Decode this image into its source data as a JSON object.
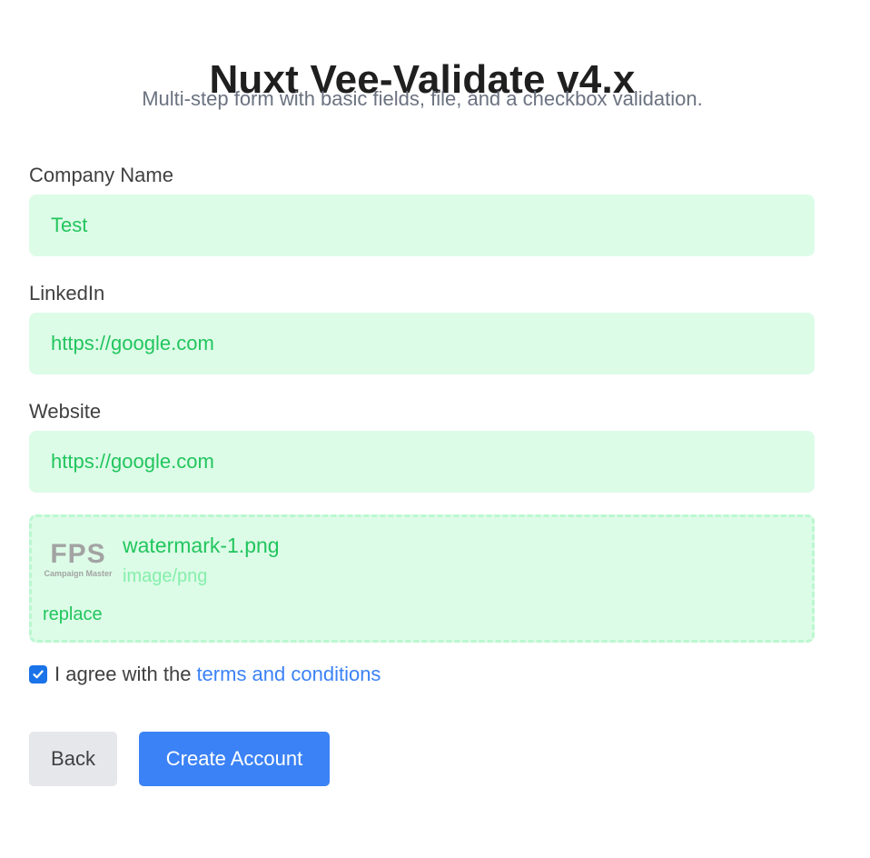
{
  "header": {
    "title": "Nuxt Vee-Validate v4.x",
    "subtitle": "Multi-step form with basic fields, file, and a checkbox validation."
  },
  "form": {
    "company_name": {
      "label": "Company Name",
      "value": "Test"
    },
    "linkedin": {
      "label": "LinkedIn",
      "value": "https://google.com"
    },
    "website": {
      "label": "Website",
      "value": "https://google.com"
    },
    "file": {
      "thumbnail_main": "FPS",
      "thumbnail_sub": "Campaign Master",
      "name": "watermark-1.png",
      "type": "image/png",
      "replace_label": "replace"
    },
    "agree": {
      "checked": true,
      "text": "I agree with the",
      "link_text": "terms and conditions"
    }
  },
  "actions": {
    "back_label": "Back",
    "create_label": "Create Account"
  },
  "colors": {
    "valid_bg": "#dcfce7",
    "valid_text": "#22c55e",
    "primary": "#3b82f6",
    "secondary_bg": "#e5e7eb"
  }
}
